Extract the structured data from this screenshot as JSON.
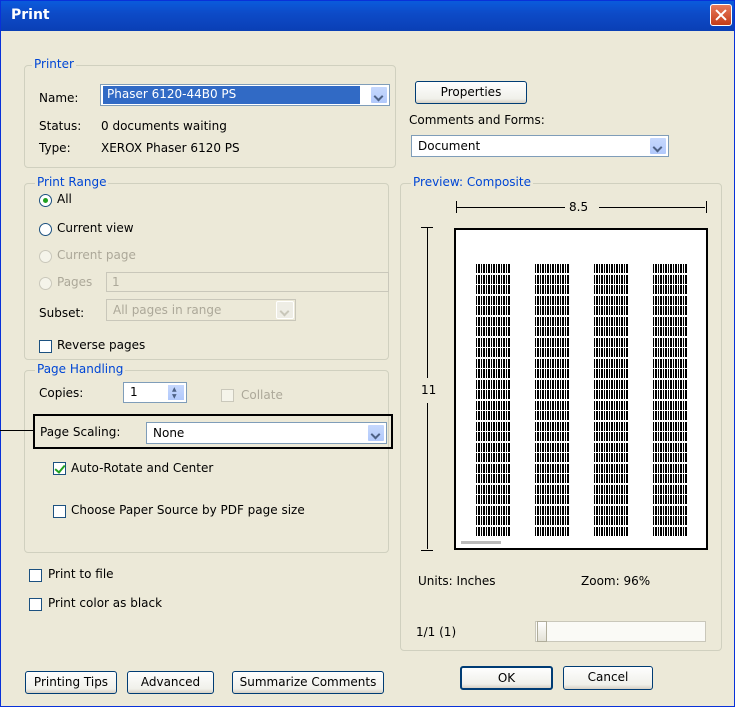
{
  "window": {
    "title": "Print"
  },
  "printer": {
    "legend": "Printer",
    "name_label": "Name:",
    "name_value": "Phaser 6120-44B0 PS",
    "status_label": "Status:",
    "status_value": "0 documents waiting",
    "type_label": "Type:",
    "type_value": "XEROX Phaser 6120 PS",
    "properties_label": "Properties",
    "comments_label": "Comments and Forms:",
    "comments_value": "Document"
  },
  "print_range": {
    "legend": "Print Range",
    "all": "All",
    "current_view": "Current view",
    "current_page": "Current page",
    "pages": "Pages",
    "pages_value": "1",
    "subset_label": "Subset:",
    "subset_value": "All pages in range",
    "reverse_pages": "Reverse pages"
  },
  "page_handling": {
    "legend": "Page Handling",
    "copies_label": "Copies:",
    "copies_value": "1",
    "collate": "Collate",
    "scaling_label": "Page Scaling:",
    "scaling_value": "None",
    "auto_rotate": "Auto-Rotate and Center",
    "paper_source": "Choose Paper Source by PDF page size"
  },
  "options": {
    "print_to_file": "Print to file",
    "print_color_black": "Print color as black"
  },
  "preview": {
    "legend": "Preview: Composite",
    "width_label": "8.5",
    "height_label": "11",
    "units": "Units: Inches",
    "zoom": "Zoom:  96%",
    "page_indicator": "1/1 (1)"
  },
  "buttons": {
    "printing_tips": "Printing Tips",
    "advanced": "Advanced",
    "summarize": "Summarize Comments",
    "ok": "OK",
    "cancel": "Cancel"
  },
  "state": {
    "range": "all",
    "auto_rotate": true,
    "reverse_pages": false,
    "collate": false,
    "paper_source": false,
    "print_to_file": false,
    "print_color_black": false
  }
}
